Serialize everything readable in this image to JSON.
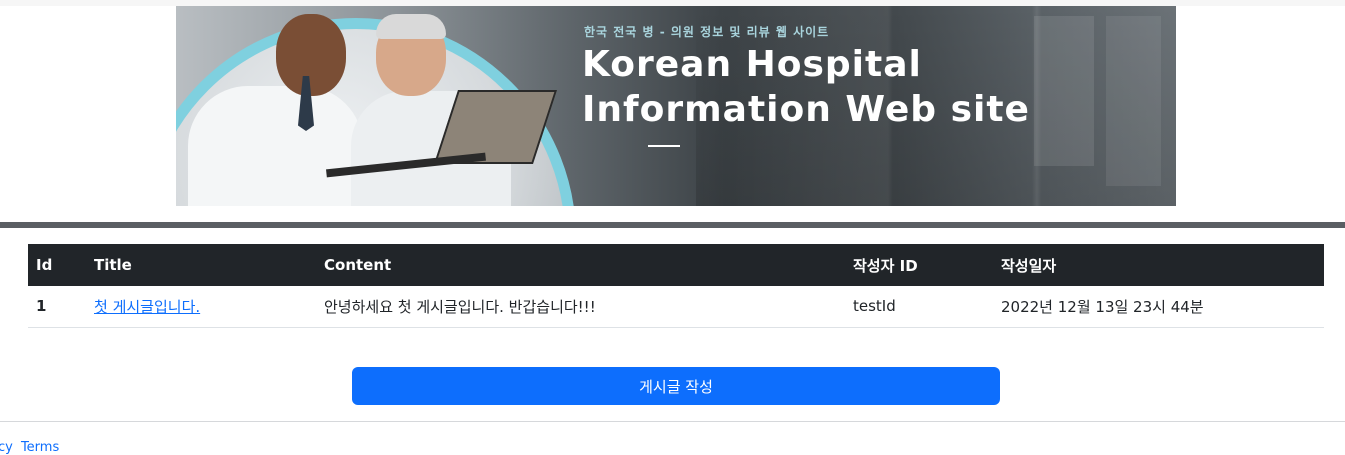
{
  "banner": {
    "subtitle": "한국 전국 병 - 의원 정보 및 리뷰 웹 사이트",
    "title_line1": "Korean Hospital",
    "title_line2": "Information Web site"
  },
  "table": {
    "headers": [
      "Id",
      "Title",
      "Content",
      "작성자 ID",
      "작성일자"
    ],
    "rows": [
      {
        "id": "1",
        "title": "첫 게시글입니다.",
        "content": "안녕하세요 첫 게시글입니다. 반갑습니다!!!",
        "author": "testId",
        "date": "2022년 12월 13일 23시 44분"
      }
    ]
  },
  "actions": {
    "write_label": "게시글 작성"
  },
  "footer": {
    "privacy_label": "acy",
    "terms_label": "Terms"
  },
  "colors": {
    "header_bg": "#212529",
    "primary": "#0d6efd",
    "divider": "#5a5e63",
    "accent_ring": "#7fd0df"
  }
}
